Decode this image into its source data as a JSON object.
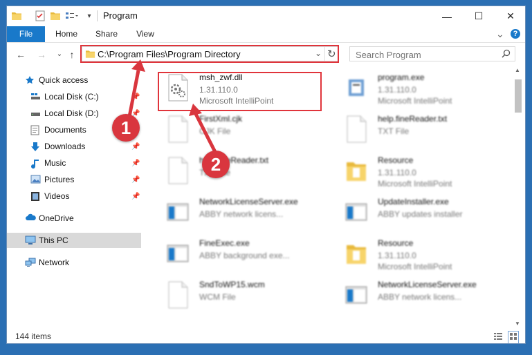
{
  "window": {
    "title": "Program"
  },
  "window_controls": {
    "minimize": "—",
    "maximize": "☐",
    "close": "✕"
  },
  "ribbon": {
    "tabs": [
      {
        "label": "File"
      },
      {
        "label": "Home"
      },
      {
        "label": "Share"
      },
      {
        "label": "View"
      }
    ],
    "expand": "⌄",
    "help": "?"
  },
  "address": {
    "path": "C:\\Program Files\\Program Directory",
    "dropdown": "⌄",
    "refresh": "↻"
  },
  "search": {
    "placeholder": "Search Program"
  },
  "nav": {
    "back": "←",
    "forward": "→",
    "recent": "⌄",
    "up": "↑",
    "items": [
      {
        "label": "Quick access"
      },
      {
        "label": "Local Disk (C:)"
      },
      {
        "label": "Local Disk (D:)"
      },
      {
        "label": "Documents"
      },
      {
        "label": "Downloads"
      },
      {
        "label": "Music"
      },
      {
        "label": "Pictures"
      },
      {
        "label": "Videos"
      },
      {
        "label": "OneDrive"
      },
      {
        "label": "This PC"
      },
      {
        "label": "Network"
      }
    ]
  },
  "files": [
    {
      "name": "msh_zwf.dll",
      "line1": "1.31.110.0",
      "line2": "Microsoft IntelliPoint",
      "icon": "dll-gear-icon"
    },
    {
      "name": "program.exe",
      "line1": "1.31.110.0",
      "line2": "Microsoft IntelliPoint",
      "icon": "exe-icon"
    },
    {
      "name": "FirstXml.cjk",
      "line1": "CJK File",
      "line2": "",
      "icon": "file-icon"
    },
    {
      "name": "help.fineReader.txt",
      "line1": "TXT File",
      "line2": "",
      "icon": "file-icon"
    },
    {
      "name": "help.fineReader.txt",
      "line1": "TXT File",
      "line2": "",
      "icon": "file-icon"
    },
    {
      "name": "Resource",
      "line1": "1.31.110.0",
      "line2": "Microsoft IntelliPoint",
      "icon": "folder-icon"
    },
    {
      "name": "NetworkLicenseServer.exe",
      "line1": "ABBY network licens...",
      "line2": "",
      "icon": "window-icon"
    },
    {
      "name": "UpdateInstaller.exe",
      "line1": "ABBY updates installer",
      "line2": "",
      "icon": "window-icon"
    },
    {
      "name": "FineExec.exe",
      "line1": "ABBY background exe...",
      "line2": "",
      "icon": "window-icon"
    },
    {
      "name": "Resource",
      "line1": "1.31.110.0",
      "line2": "Microsoft IntelliPoint",
      "icon": "folder-icon"
    },
    {
      "name": "SndToWP15.wcm",
      "line1": "WCM File",
      "line2": "",
      "icon": "file-icon"
    },
    {
      "name": "NetworkLicenseServer.exe",
      "line1": "ABBY network licens...",
      "line2": "",
      "icon": "window-icon"
    }
  ],
  "status": {
    "count": "144 items"
  },
  "annotations": [
    {
      "number": "1"
    },
    {
      "number": "2"
    }
  ],
  "colors": {
    "accent": "#1979ca",
    "highlight": "#e0343b",
    "badge": "#d9363e",
    "selected": "#d9d9d9"
  }
}
